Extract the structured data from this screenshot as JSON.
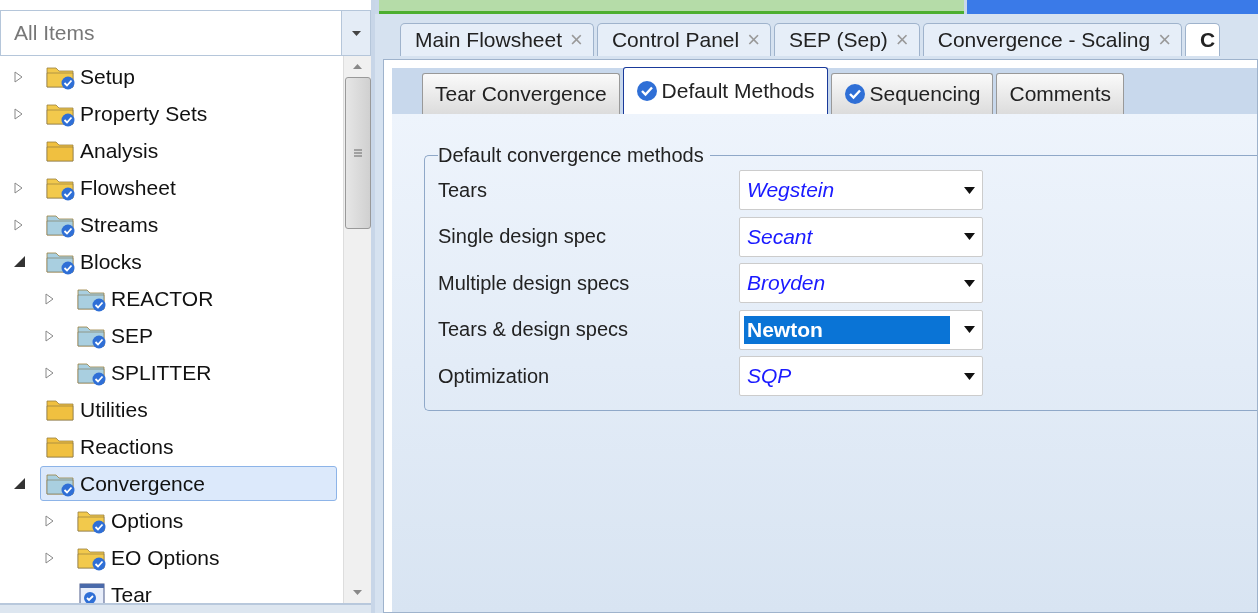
{
  "navigator": {
    "filter": {
      "value": "All Items"
    },
    "tree": [
      {
        "label": "Setup",
        "kind": "check-folder",
        "expanded": false,
        "selected": false
      },
      {
        "label": "Property Sets",
        "kind": "check-folder",
        "expanded": false,
        "selected": false
      },
      {
        "label": "Analysis",
        "kind": "folder",
        "selected": false
      },
      {
        "label": "Flowsheet",
        "kind": "check-folder",
        "expanded": false,
        "selected": false
      },
      {
        "label": "Streams",
        "kind": "teal-folder",
        "expanded": false,
        "selected": false
      },
      {
        "label": "Blocks",
        "kind": "teal-folder",
        "expanded": true,
        "selected": false,
        "children": [
          {
            "label": "REACTOR",
            "kind": "teal-folder",
            "expanded": false,
            "selected": false
          },
          {
            "label": "SEP",
            "kind": "teal-folder",
            "expanded": false,
            "selected": false
          },
          {
            "label": "SPLITTER",
            "kind": "teal-folder",
            "expanded": false,
            "selected": false
          }
        ]
      },
      {
        "label": "Utilities",
        "kind": "folder",
        "selected": false
      },
      {
        "label": "Reactions",
        "kind": "folder",
        "selected": false
      },
      {
        "label": "Convergence",
        "kind": "teal-folder",
        "expanded": true,
        "selected": true,
        "children": [
          {
            "label": "Options",
            "kind": "check-folder",
            "expanded": false,
            "selected": false
          },
          {
            "label": "EO Options",
            "kind": "check-folder",
            "expanded": false,
            "selected": false
          },
          {
            "label": "Tear",
            "kind": "form",
            "selected": false
          }
        ]
      }
    ]
  },
  "document_tabs": [
    {
      "label": "Main Flowsheet",
      "close": "×",
      "selected": false
    },
    {
      "label": "Control Panel",
      "close": "×",
      "selected": false
    },
    {
      "label": "SEP (Sep)",
      "close": "×",
      "selected": false
    },
    {
      "label": "Convergence - Scaling",
      "close": "×",
      "selected": false
    },
    {
      "label": "C",
      "selected": true
    }
  ],
  "form_tabs": [
    {
      "label": "Tear Convergence",
      "checked": false,
      "selected": false
    },
    {
      "label": "Default Methods",
      "checked": true,
      "selected": true
    },
    {
      "label": "Sequencing",
      "checked": true,
      "selected": false
    },
    {
      "label": "Comments",
      "checked": false,
      "selected": false
    }
  ],
  "group": {
    "title": "Default convergence methods",
    "rows": [
      {
        "label": "Tears",
        "value": "Wegstein",
        "highlighted": false
      },
      {
        "label": "Single design spec",
        "value": "Secant",
        "highlighted": false
      },
      {
        "label": "Multiple design specs",
        "value": "Broyden",
        "highlighted": false
      },
      {
        "label": "Tears & design specs",
        "value": "Newton",
        "highlighted": true
      },
      {
        "label": "Optimization",
        "value": "SQP",
        "highlighted": false
      }
    ]
  }
}
